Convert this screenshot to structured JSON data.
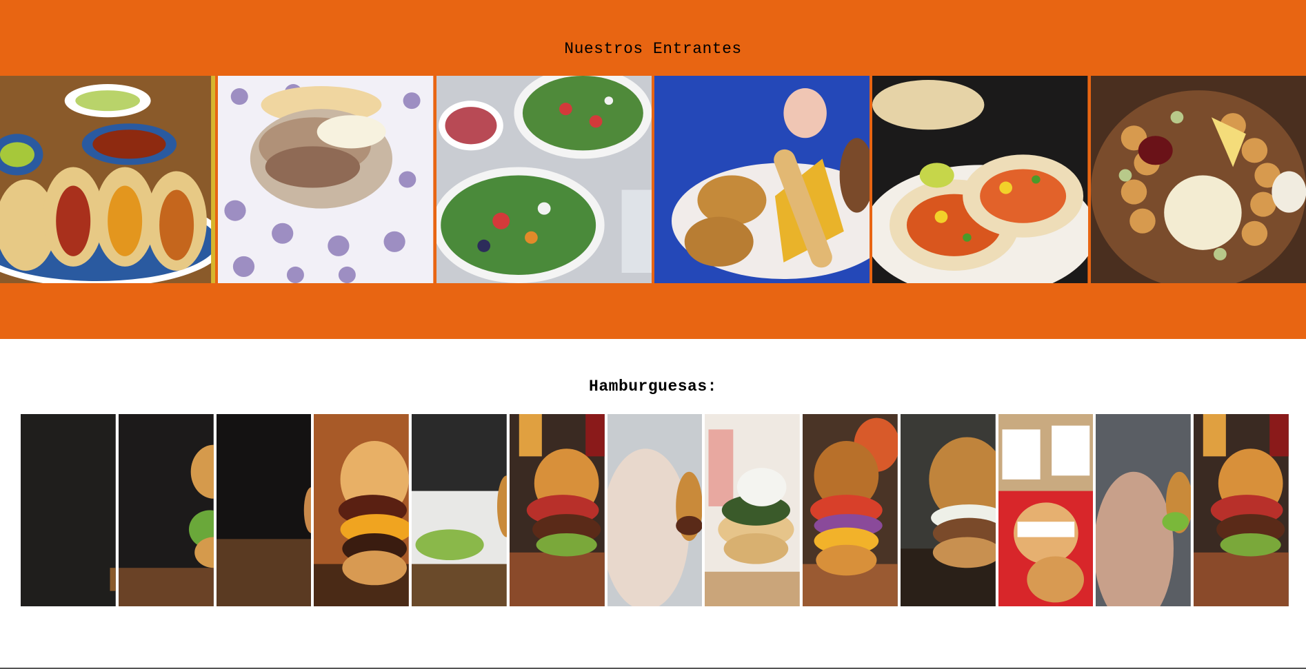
{
  "colors": {
    "band": "#e86512",
    "page_bg": "#ffffff",
    "rule": "#555555"
  },
  "entrantes": {
    "title": "Nuestros Entrantes",
    "images": [
      {
        "name": "tacos-plate-image",
        "subject": "tacos"
      },
      {
        "name": "arepa-pulled-meat-image",
        "subject": "arepa"
      },
      {
        "name": "salad-bowls-image",
        "subject": "salad"
      },
      {
        "name": "fried-snacks-image",
        "subject": "tequenos"
      },
      {
        "name": "chicken-tacos-image",
        "subject": "tacos"
      },
      {
        "name": "charcuterie-board-image",
        "subject": "cheese board"
      }
    ]
  },
  "hamburguesas": {
    "title": "Hamburguesas:",
    "images": [
      {
        "name": "burger-image-1"
      },
      {
        "name": "burger-image-2"
      },
      {
        "name": "burger-image-3"
      },
      {
        "name": "burger-image-4"
      },
      {
        "name": "burger-image-5"
      },
      {
        "name": "burger-image-6"
      },
      {
        "name": "burger-image-7"
      },
      {
        "name": "burger-image-8"
      },
      {
        "name": "burger-image-9"
      },
      {
        "name": "burger-image-10"
      },
      {
        "name": "burger-image-11"
      },
      {
        "name": "burger-image-12"
      },
      {
        "name": "burger-image-13"
      }
    ]
  }
}
